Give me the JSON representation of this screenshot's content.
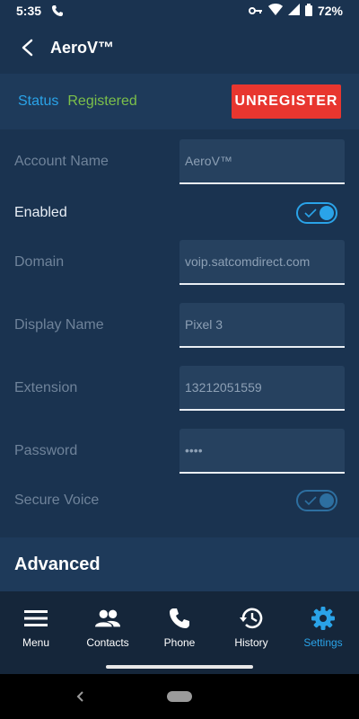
{
  "status_bar": {
    "time": "5:35",
    "battery": "72%",
    "icons": [
      "call-forwarding-icon",
      "vpn-key-icon",
      "wifi-icon",
      "signal-icon",
      "battery-icon"
    ]
  },
  "app_bar": {
    "title": "AeroV™",
    "back_icon": "arrow-back-icon"
  },
  "registration": {
    "label": "Status",
    "value": "Registered",
    "button_label": "UNREGISTER"
  },
  "form": {
    "account_name": {
      "label": "Account Name",
      "value": "AeroV™"
    },
    "enabled": {
      "label": "Enabled",
      "on": true
    },
    "domain": {
      "label": "Domain",
      "value": "voip.satcomdirect.com"
    },
    "display_name": {
      "label": "Display Name",
      "value": "Pixel 3"
    },
    "extension": {
      "label": "Extension",
      "value": "13212051559"
    },
    "password": {
      "label": "Password",
      "value": "••••"
    },
    "secure_voice": {
      "label": "Secure Voice",
      "on": true
    }
  },
  "advanced": {
    "label": "Advanced"
  },
  "bottom_nav": {
    "items": [
      {
        "label": "Menu",
        "icon": "menu-icon",
        "active": false
      },
      {
        "label": "Contacts",
        "icon": "contacts-icon",
        "active": false
      },
      {
        "label": "Phone",
        "icon": "phone-icon",
        "active": false
      },
      {
        "label": "History",
        "icon": "history-icon",
        "active": false
      },
      {
        "label": "Settings",
        "icon": "settings-icon",
        "active": true
      }
    ]
  },
  "colors": {
    "accent": "#2aa3e8",
    "registered": "#7cc04a",
    "unregister": "#e8362f",
    "background": "#1a3350"
  }
}
